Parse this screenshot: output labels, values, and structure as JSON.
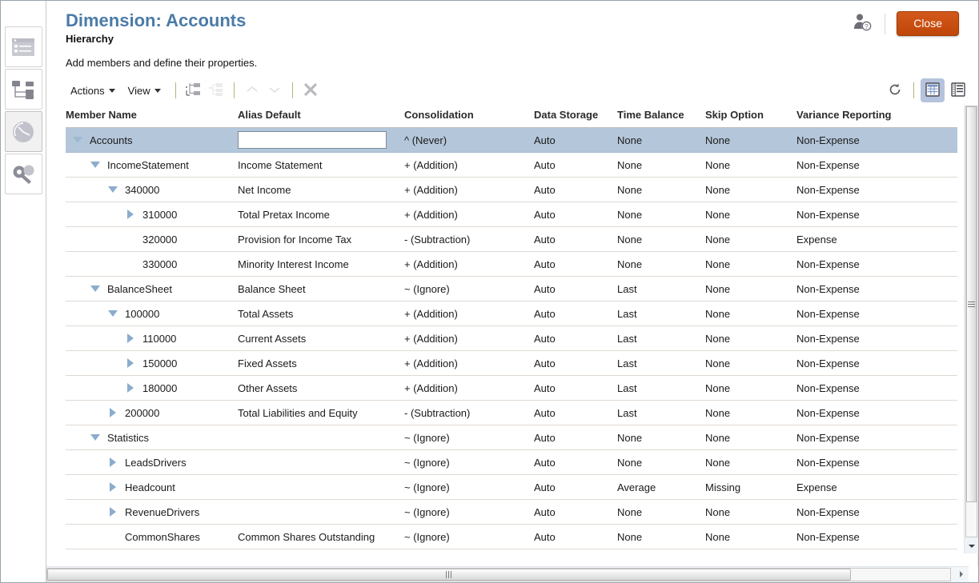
{
  "window": {
    "title": "Dimension: Accounts"
  },
  "header": {
    "title": "Dimension: Accounts",
    "subtitle": "Hierarchy",
    "description": "Add members and define their properties.",
    "help_icon": "user-help-icon",
    "close_label": "Close",
    "accent_color": "#4a7ba7",
    "close_button_color": "#c44f0f"
  },
  "sidebar": {
    "items": [
      {
        "name": "sidebar-item-form",
        "icon": "form-list-icon",
        "selected": false
      },
      {
        "name": "sidebar-item-hierarchy",
        "icon": "hierarchy-tree-icon",
        "selected": false
      },
      {
        "name": "sidebar-item-performance",
        "icon": "clock-pie-icon",
        "selected": true
      },
      {
        "name": "sidebar-item-security",
        "icon": "key-icon",
        "selected": false
      }
    ]
  },
  "toolbar": {
    "menus": [
      {
        "label": "Actions",
        "name": "actions-menu"
      },
      {
        "label": "View",
        "name": "view-menu"
      }
    ],
    "buttons": [
      {
        "name": "add-child-button",
        "icon": "add-child-icon",
        "enabled": true
      },
      {
        "name": "add-sibling-button",
        "icon": "add-sibling-icon",
        "enabled": false
      },
      {
        "name": "move-up-button",
        "icon": "chevron-up-icon",
        "enabled": false
      },
      {
        "name": "move-down-button",
        "icon": "chevron-down-icon",
        "enabled": false
      },
      {
        "name": "delete-member-button",
        "icon": "close-x-icon",
        "enabled": true
      }
    ],
    "right_buttons": [
      {
        "name": "refresh-button",
        "icon": "refresh-icon",
        "active": false
      },
      {
        "name": "grid-view-button",
        "icon": "grid-view-icon",
        "active": true
      },
      {
        "name": "detail-view-button",
        "icon": "detail-view-icon",
        "active": false
      }
    ]
  },
  "grid": {
    "columns": [
      {
        "key": "member",
        "label": "Member Name"
      },
      {
        "key": "alias",
        "label": "Alias Default"
      },
      {
        "key": "consolidation",
        "label": "Consolidation"
      },
      {
        "key": "storage",
        "label": "Data Storage"
      },
      {
        "key": "time_balance",
        "label": "Time Balance"
      },
      {
        "key": "skip",
        "label": "Skip Option"
      },
      {
        "key": "variance",
        "label": "Variance Reporting"
      }
    ],
    "rows": [
      {
        "member": "Accounts",
        "level": 0,
        "twisty": "expanded",
        "selected": true,
        "alias": "",
        "alias_editing": true,
        "alias_placeholder": "",
        "consolidation": "^ (Never)",
        "storage": "Auto",
        "time_balance": "None",
        "skip": "None",
        "variance": "Non-Expense"
      },
      {
        "member": "IncomeStatement",
        "level": 1,
        "twisty": "expanded",
        "selected": false,
        "alias": "Income Statement",
        "alias_editing": false,
        "consolidation": "+ (Addition)",
        "storage": "Auto",
        "time_balance": "None",
        "skip": "None",
        "variance": "Non-Expense"
      },
      {
        "member": "340000",
        "level": 2,
        "twisty": "expanded",
        "selected": false,
        "alias": "Net Income",
        "alias_editing": false,
        "consolidation": "+ (Addition)",
        "storage": "Auto",
        "time_balance": "None",
        "skip": "None",
        "variance": "Non-Expense"
      },
      {
        "member": "310000",
        "level": 3,
        "twisty": "collapsed",
        "selected": false,
        "alias": "Total Pretax Income",
        "alias_editing": false,
        "consolidation": "+ (Addition)",
        "storage": "Auto",
        "time_balance": "None",
        "skip": "None",
        "variance": "Non-Expense"
      },
      {
        "member": "320000",
        "level": 3,
        "twisty": "none",
        "selected": false,
        "alias": "Provision for Income Tax",
        "alias_editing": false,
        "consolidation": "- (Subtraction)",
        "storage": "Auto",
        "time_balance": "None",
        "skip": "None",
        "variance": "Expense"
      },
      {
        "member": "330000",
        "level": 3,
        "twisty": "none",
        "selected": false,
        "alias": "Minority Interest Income",
        "alias_editing": false,
        "consolidation": "+ (Addition)",
        "storage": "Auto",
        "time_balance": "None",
        "skip": "None",
        "variance": "Non-Expense"
      },
      {
        "member": "BalanceSheet",
        "level": 1,
        "twisty": "expanded",
        "selected": false,
        "alias": "Balance Sheet",
        "alias_editing": false,
        "consolidation": "~ (Ignore)",
        "storage": "Auto",
        "time_balance": "Last",
        "skip": "None",
        "variance": "Non-Expense"
      },
      {
        "member": "100000",
        "level": 2,
        "twisty": "expanded",
        "selected": false,
        "alias": "Total Assets",
        "alias_editing": false,
        "consolidation": "+ (Addition)",
        "storage": "Auto",
        "time_balance": "Last",
        "skip": "None",
        "variance": "Non-Expense"
      },
      {
        "member": "110000",
        "level": 3,
        "twisty": "collapsed",
        "selected": false,
        "alias": "Current Assets",
        "alias_editing": false,
        "consolidation": "+ (Addition)",
        "storage": "Auto",
        "time_balance": "Last",
        "skip": "None",
        "variance": "Non-Expense"
      },
      {
        "member": "150000",
        "level": 3,
        "twisty": "collapsed",
        "selected": false,
        "alias": "Fixed Assets",
        "alias_editing": false,
        "consolidation": "+ (Addition)",
        "storage": "Auto",
        "time_balance": "Last",
        "skip": "None",
        "variance": "Non-Expense"
      },
      {
        "member": "180000",
        "level": 3,
        "twisty": "collapsed",
        "selected": false,
        "alias": "Other Assets",
        "alias_editing": false,
        "consolidation": "+ (Addition)",
        "storage": "Auto",
        "time_balance": "Last",
        "skip": "None",
        "variance": "Non-Expense"
      },
      {
        "member": "200000",
        "level": 2,
        "twisty": "collapsed",
        "selected": false,
        "alias": "Total Liabilities and Equity",
        "alias_editing": false,
        "consolidation": "- (Subtraction)",
        "storage": "Auto",
        "time_balance": "Last",
        "skip": "None",
        "variance": "Non-Expense"
      },
      {
        "member": "Statistics",
        "level": 1,
        "twisty": "expanded",
        "selected": false,
        "alias": "",
        "alias_editing": false,
        "consolidation": "~ (Ignore)",
        "storage": "Auto",
        "time_balance": "None",
        "skip": "None",
        "variance": "Non-Expense"
      },
      {
        "member": "LeadsDrivers",
        "level": 2,
        "twisty": "collapsed",
        "selected": false,
        "alias": "",
        "alias_editing": false,
        "consolidation": "~ (Ignore)",
        "storage": "Auto",
        "time_balance": "None",
        "skip": "None",
        "variance": "Non-Expense"
      },
      {
        "member": "Headcount",
        "level": 2,
        "twisty": "collapsed",
        "selected": false,
        "alias": "",
        "alias_editing": false,
        "consolidation": "~ (Ignore)",
        "storage": "Auto",
        "time_balance": "Average",
        "skip": "Missing",
        "variance": "Expense"
      },
      {
        "member": "RevenueDrivers",
        "level": 2,
        "twisty": "collapsed",
        "selected": false,
        "alias": "",
        "alias_editing": false,
        "consolidation": "~ (Ignore)",
        "storage": "Auto",
        "time_balance": "None",
        "skip": "None",
        "variance": "Non-Expense"
      },
      {
        "member": "CommonShares",
        "level": 2,
        "twisty": "none",
        "selected": false,
        "alias": "Common Shares Outstanding",
        "alias_editing": false,
        "consolidation": "~ (Ignore)",
        "storage": "Auto",
        "time_balance": "None",
        "skip": "None",
        "variance": "Non-Expense"
      }
    ]
  },
  "scrollbars": {
    "horizontal": {
      "name": "horizontal-scrollbar",
      "thumb_percent": 89
    },
    "vertical": {
      "name": "vertical-scrollbar",
      "thumb_percent": 92
    }
  }
}
